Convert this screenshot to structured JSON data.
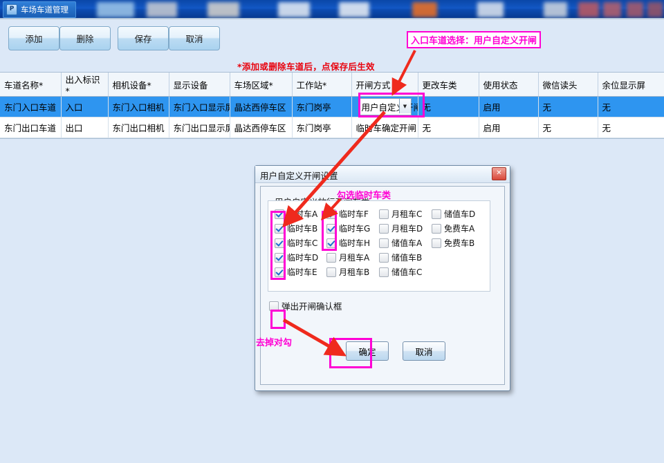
{
  "taskbar": {
    "window_title": "车场车道管理",
    "app_icon": "app-icon"
  },
  "toolbar": {
    "add_label": "添加",
    "delete_label": "删除",
    "save_label": "保存",
    "cancel_label": "取消",
    "hint_text": "*添加或删除车道后，点保存后生效",
    "hint_color": "#e8000c"
  },
  "callout": {
    "entry_lane_label": "入口车道选择：用户自定义开闸",
    "check_temp_label": "勾选临时车类",
    "uncheck_label": "去掉对勾",
    "accent_color": "#ff00d4"
  },
  "grid": {
    "columns": [
      "车道名称*",
      "出入标识*",
      "相机设备*",
      "显示设备",
      "车场区域*",
      "工作站*",
      "开闸方式",
      "更改车类",
      "使用状态",
      "微信读头",
      "余位显示屏"
    ],
    "rows": [
      {
        "selected": true,
        "cells": [
          "东门入口车道",
          "入口",
          "东门入口相机",
          "东门入口显示屏",
          "晶达西停车区",
          "东门岗亭",
          "用户自定义开闸",
          "无",
          "启用",
          "无",
          "无"
        ],
        "combo_index": 6
      },
      {
        "selected": false,
        "cells": [
          "东门出口车道",
          "出口",
          "东门出口相机",
          "东门出口显示屏",
          "晶达西停车区",
          "东门岗亭",
          "临时车确定开闸",
          "无",
          "启用",
          "无",
          "无"
        ],
        "combo_index": -1
      }
    ],
    "selected_row_color": "#2e95f0"
  },
  "dialog": {
    "title": "用户自定义开闸设置",
    "close_label": "✕",
    "group_label": "用户自定义放行开闸车类",
    "columns": [
      [
        {
          "label": "临时车A",
          "checked": true
        },
        {
          "label": "临时车B",
          "checked": true
        },
        {
          "label": "临时车C",
          "checked": true
        },
        {
          "label": "临时车D",
          "checked": true
        },
        {
          "label": "临时车E",
          "checked": true
        }
      ],
      [
        {
          "label": "临时车F",
          "checked": true
        },
        {
          "label": "临时车G",
          "checked": true
        },
        {
          "label": "临时车H",
          "checked": true
        },
        {
          "label": "月租车A",
          "checked": false
        },
        {
          "label": "月租车B",
          "checked": false
        }
      ],
      [
        {
          "label": "月租车C",
          "checked": false
        },
        {
          "label": "月租车D",
          "checked": false
        },
        {
          "label": "储值车A",
          "checked": false
        },
        {
          "label": "储值车B",
          "checked": false
        },
        {
          "label": "储值车C",
          "checked": false
        }
      ],
      [
        {
          "label": "储值车D",
          "checked": false
        },
        {
          "label": "免费车A",
          "checked": false
        },
        {
          "label": "免费车B",
          "checked": false
        }
      ]
    ],
    "confirm_checkbox": {
      "label": "弹出开闸确认框",
      "checked": false
    },
    "ok_label": "确定",
    "cancel_label": "取消"
  }
}
